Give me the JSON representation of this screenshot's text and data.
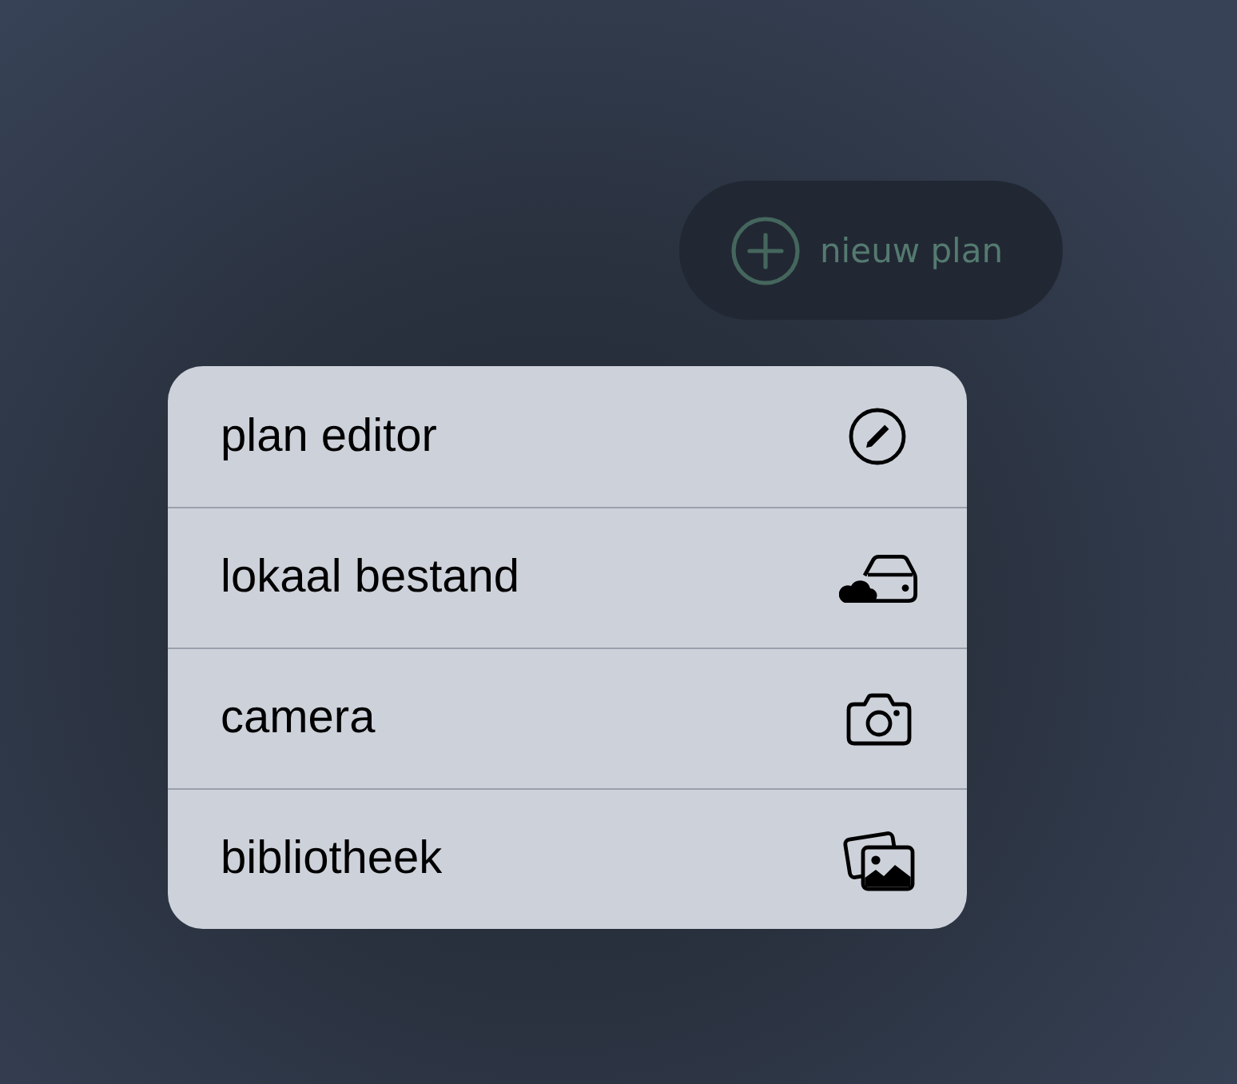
{
  "new_plan_button": {
    "label": "nieuw plan"
  },
  "menu": {
    "items": [
      {
        "label": "plan editor",
        "kind": "editor"
      },
      {
        "label": "lokaal bestand",
        "kind": "file"
      },
      {
        "label": "camera",
        "kind": "camera"
      },
      {
        "label": "bibliotheek",
        "kind": "library"
      }
    ]
  }
}
